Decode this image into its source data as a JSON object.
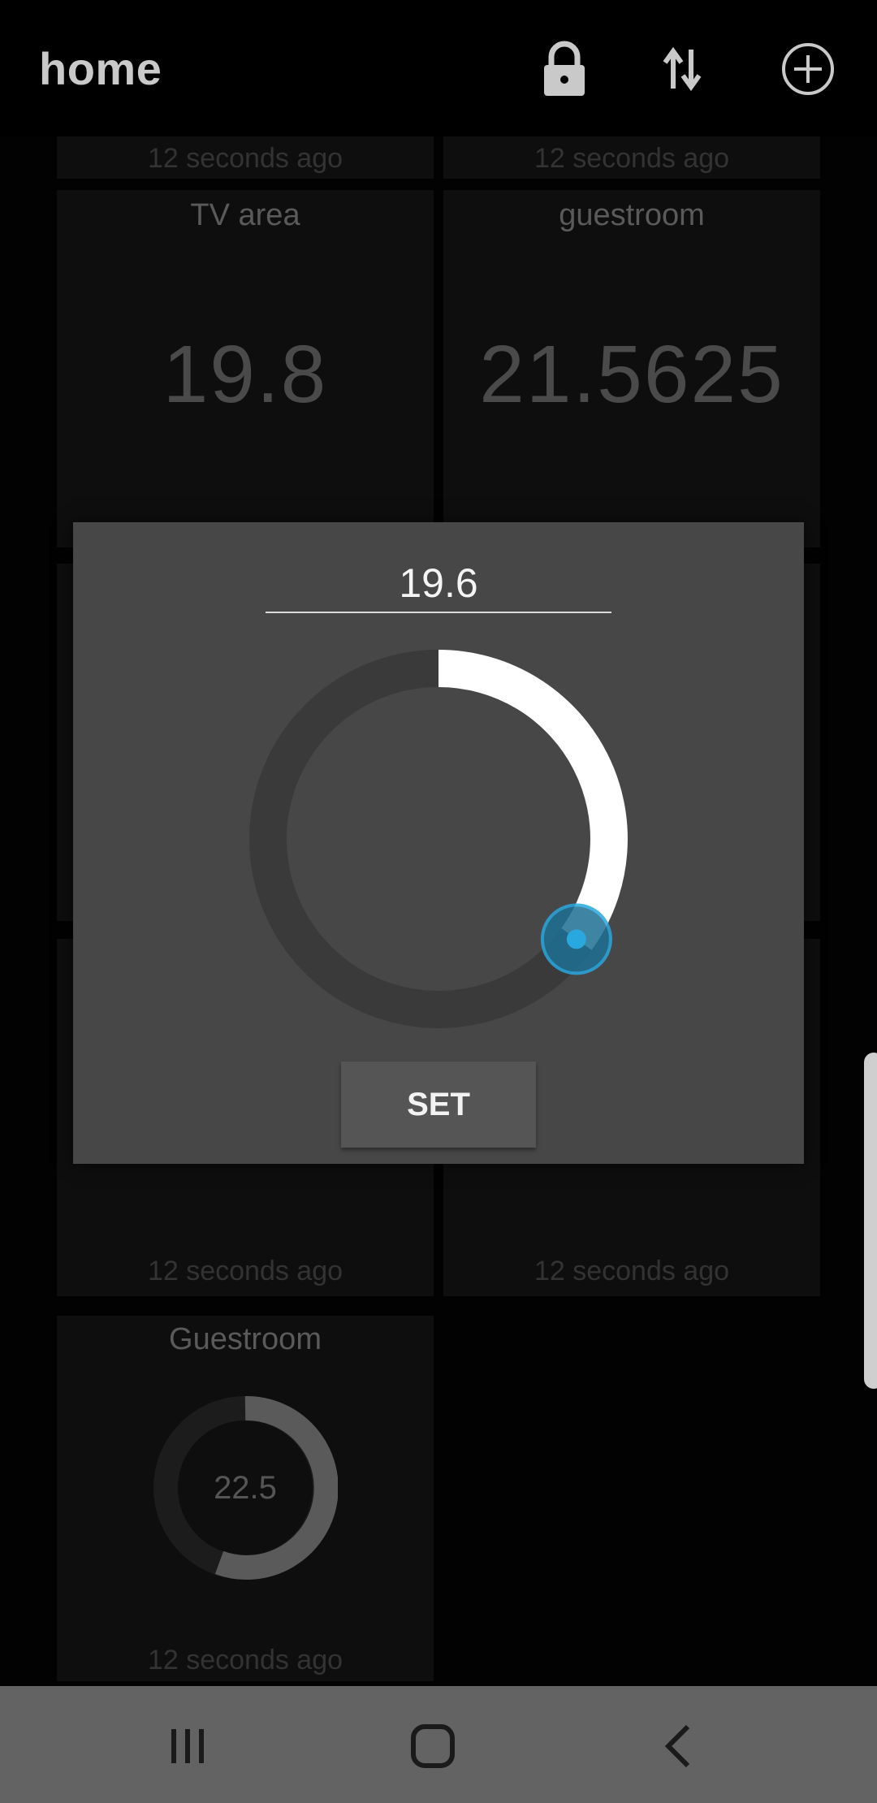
{
  "app_bar": {
    "title": "home",
    "icons": [
      "lock-icon",
      "sort-arrows-icon",
      "add-circle-icon"
    ]
  },
  "tiles": {
    "top_left_time": "12 seconds ago",
    "top_right_time": "12 seconds ago",
    "tv_area": {
      "name": "TV area",
      "value": "19.8"
    },
    "guestroom": {
      "name": "guestroom",
      "value": "21.5625"
    },
    "lower_left_time": "12 seconds ago",
    "lower_right_time": "12 seconds ago",
    "guestroom_gauge": {
      "name": "Guestroom",
      "value": "22.5",
      "time": "12 seconds ago"
    }
  },
  "dialog": {
    "input_value": "19.6",
    "set_label": "SET",
    "dial_fraction": 0.35,
    "accent_color": "#29a8e0"
  },
  "nav_bar": {
    "icons": [
      "recents-icon",
      "home-icon",
      "back-icon"
    ]
  }
}
